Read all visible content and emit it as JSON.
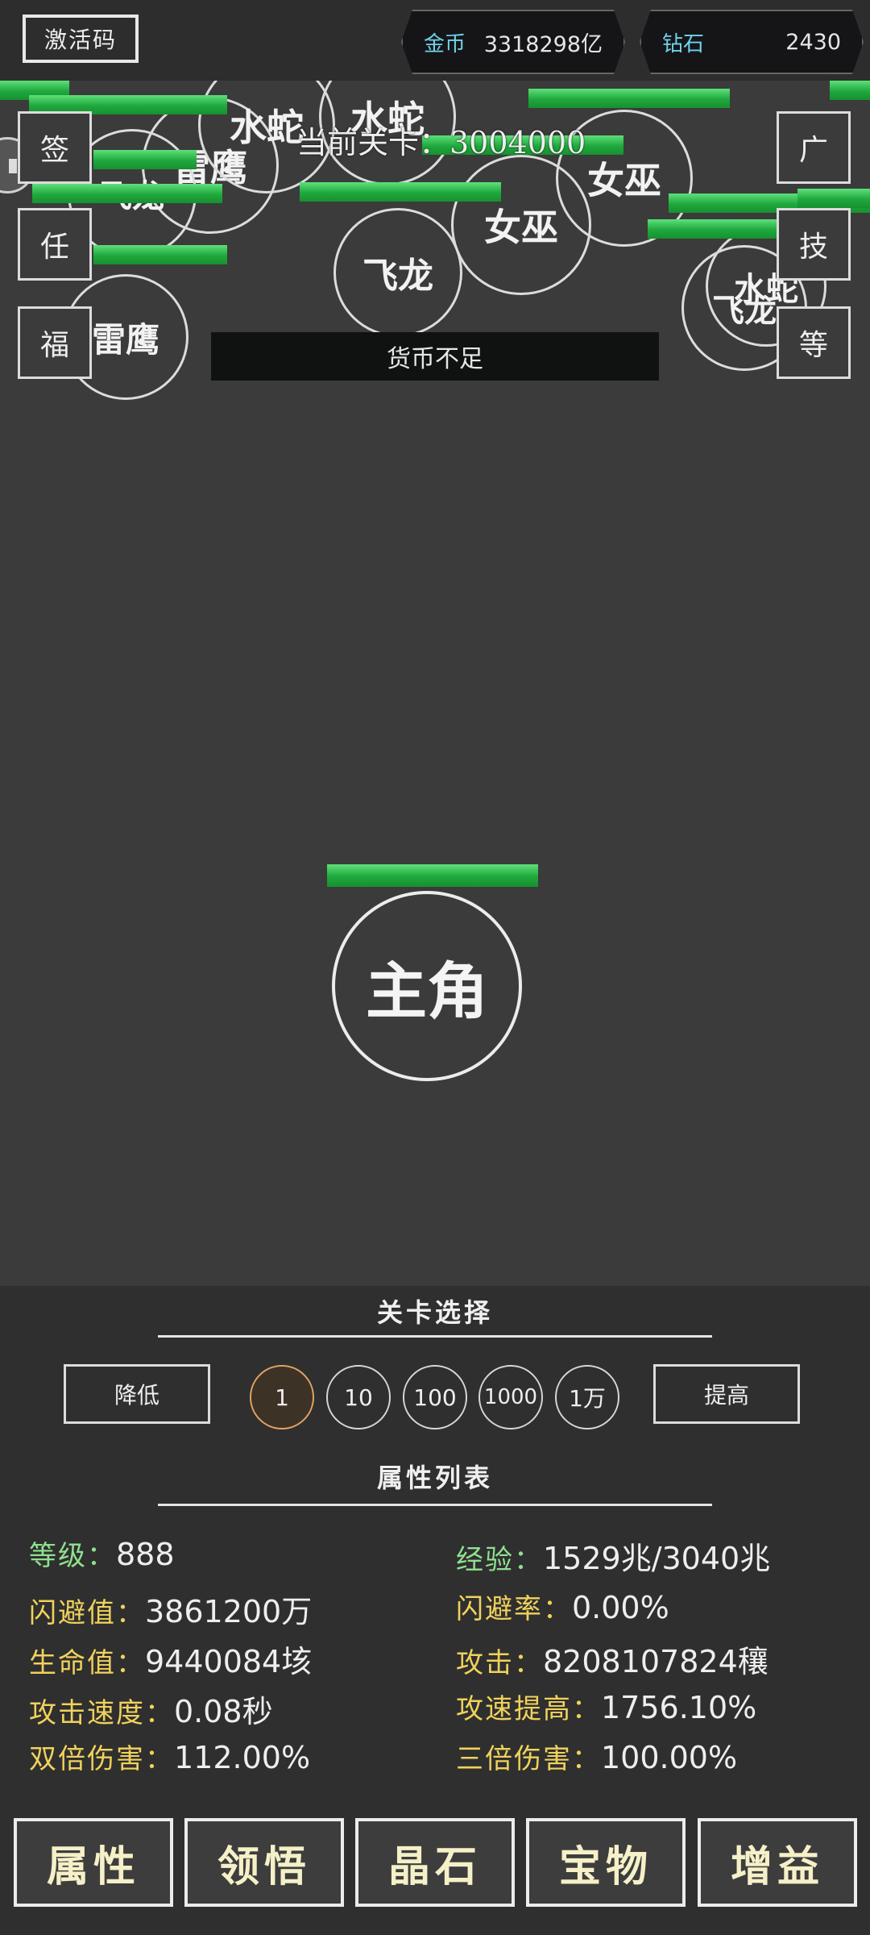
{
  "header": {
    "activation_code_label": "激活码",
    "gold": {
      "label": "金币",
      "value": "3318298亿"
    },
    "diamond": {
      "label": "钻石",
      "value": "2430"
    }
  },
  "battle": {
    "current_wave_text": "当前关卡：3004000",
    "toast": "货币不足",
    "hero_label": "主角",
    "enemies": {
      "thunder_hawk": "雷鹰",
      "water_snake": "水蛇",
      "witch": "女巫",
      "flying_dragon": "飞龙"
    },
    "left_buttons": [
      "签",
      "任",
      "福"
    ],
    "right_buttons": [
      "广",
      "技",
      "等"
    ]
  },
  "level_select": {
    "title": "关卡选择",
    "decrease_label": "降低",
    "increase_label": "提高",
    "steps": [
      "1",
      "10",
      "100",
      "1000",
      "1万"
    ],
    "selected_step": "1"
  },
  "attributes": {
    "title": "属性列表",
    "level": {
      "label": "等级：",
      "value": "888"
    },
    "exp": {
      "label": "经验：",
      "value": "1529兆/3040兆"
    },
    "dodge_value": {
      "label": "闪避值：",
      "value": "3861200万"
    },
    "dodge_rate": {
      "label": "闪避率：",
      "value": "0.00%"
    },
    "hp": {
      "label": "生命值：",
      "value": "9440084垓"
    },
    "attack": {
      "label": "攻击：",
      "value": "8208107824穰"
    },
    "attack_speed": {
      "label": "攻击速度：",
      "value": "0.08秒"
    },
    "attack_speed_boost": {
      "label": "攻速提高：",
      "value": "1756.10%"
    },
    "double_damage": {
      "label": "双倍伤害：",
      "value": "112.00%"
    },
    "triple_damage": {
      "label": "三倍伤害：",
      "value": "100.00%"
    }
  },
  "tabs": [
    "属性",
    "领悟",
    "晶石",
    "宝物",
    "增益"
  ]
}
